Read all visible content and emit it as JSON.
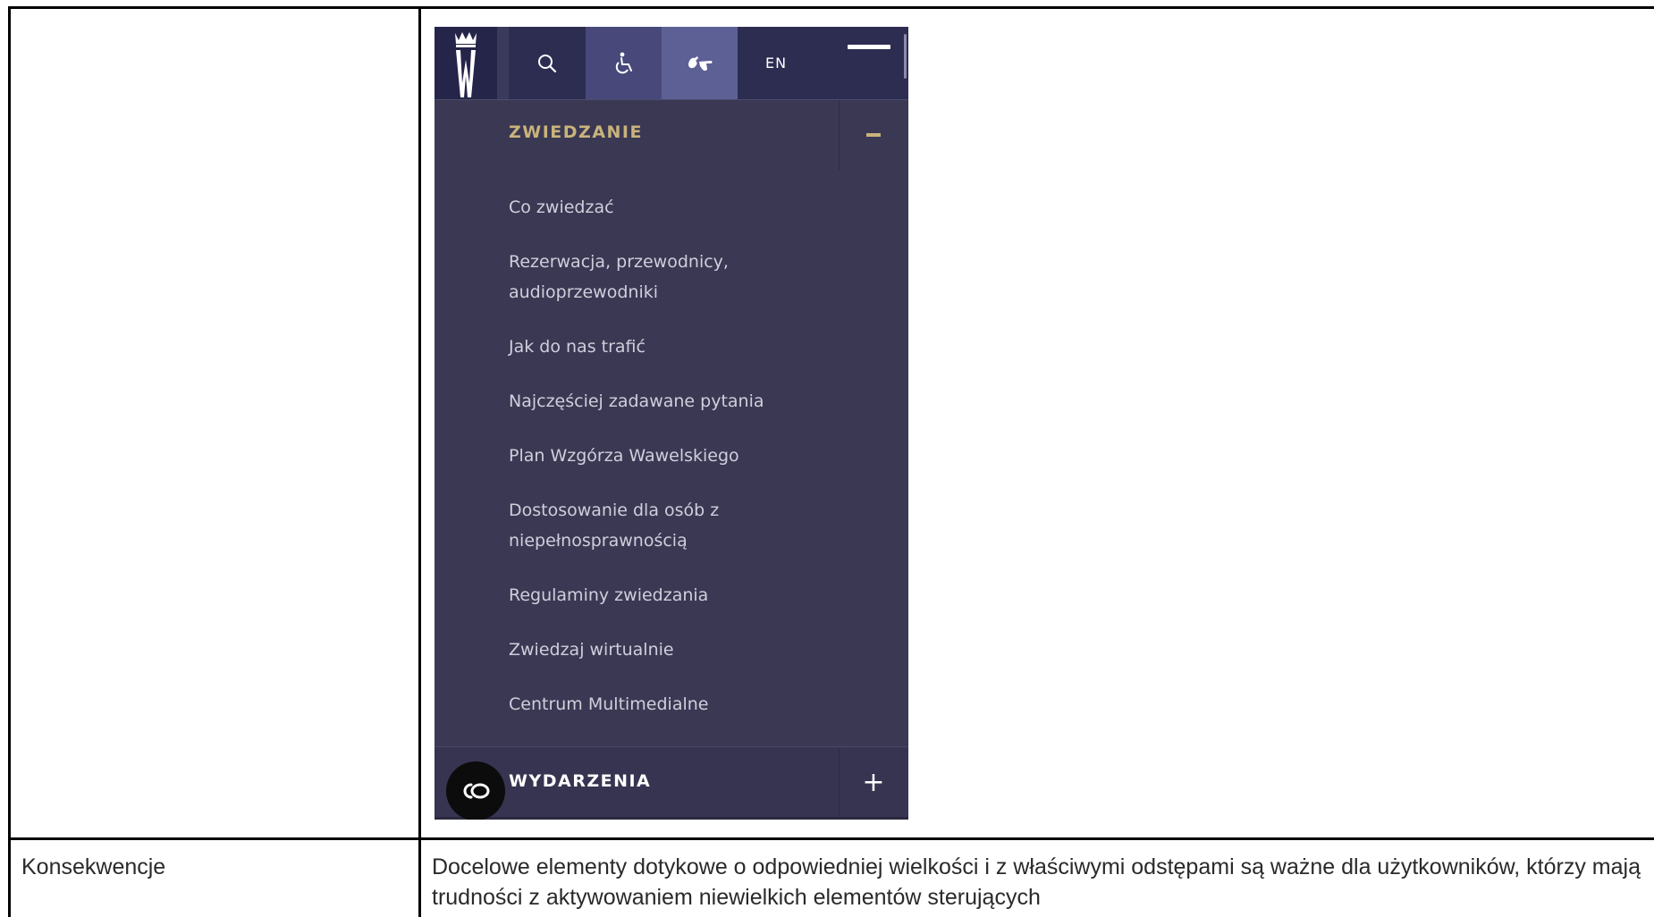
{
  "table": {
    "row2_label": "Konsekwencje",
    "row2_text": "Docelowe elementy dotykowe o odpowiedniej wielkości i z właściwymi odstępami są ważne dla użytkowników, którzy mają trudności z aktywowaniem niewielkich elementów sterujących"
  },
  "phone": {
    "icons": {
      "logo": "wawel-crown-w-logo",
      "search": "search-icon",
      "wheelchair": "wheelchair-icon",
      "sign_language": "sign-language-icon",
      "menu": "hamburger-icon",
      "accessibility_fab": "accessibility-widget-icon"
    },
    "lang_label": "EN",
    "colors": {
      "panel_bg": "#3a3853",
      "active_section": "#c9b37b",
      "submenu_text": "#cfcfdc"
    },
    "sections": [
      {
        "title": "ZWIEDZANIE",
        "expanded": true,
        "toggle": "−",
        "items": [
          "Co zwiedzać",
          "Rezerwacja, przewodnicy, audioprzewodniki",
          "Jak do nas trafić",
          "Najczęściej zadawane pytania",
          "Plan Wzgórza Wawelskiego",
          "Dostosowanie dla osób z niepełnosprawnością",
          "Regulaminy zwiedzania",
          "Zwiedzaj wirtualnie",
          "Centrum Multimedialne"
        ]
      },
      {
        "title": "WYDARZENIA",
        "expanded": false,
        "toggle": "+"
      }
    ]
  }
}
